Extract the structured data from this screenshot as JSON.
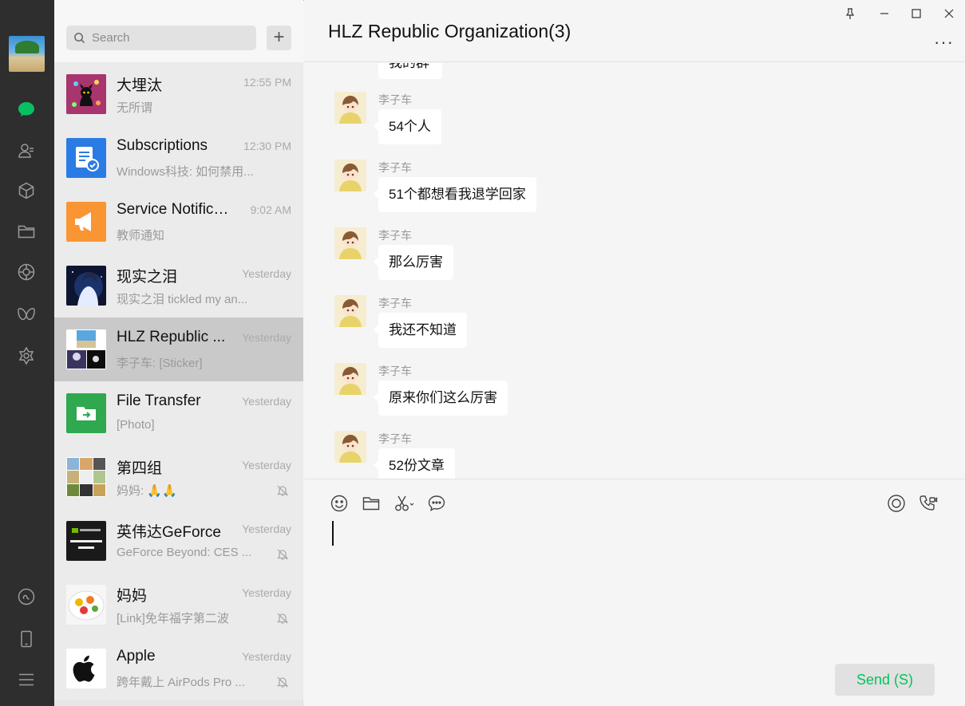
{
  "window": {
    "chat_title": "HLZ Republic Organization(3)",
    "more_label": "···"
  },
  "rail": {
    "items": [
      "chat-icon",
      "contacts-icon",
      "favorites-icon",
      "files-icon",
      "moments-icon",
      "channels-icon",
      "mini-programs-icon",
      "mini-program-link-icon",
      "phone-icon",
      "menu-icon"
    ],
    "accent": "#07c160"
  },
  "search": {
    "placeholder": "Search",
    "add_label": "+"
  },
  "chats": [
    {
      "name": "大埋汰",
      "time": "12:55 PM",
      "preview": "无所谓",
      "muted": false
    },
    {
      "name": "Subscriptions",
      "time": "12:30 PM",
      "preview": "Windows科技: 如何禁用...",
      "muted": false
    },
    {
      "name": "Service Notificat...",
      "time": "9:02 AM",
      "preview": "教师通知",
      "muted": false
    },
    {
      "name": "现实之泪",
      "time": "Yesterday",
      "preview": "现实之泪 tickled my  an...",
      "muted": false
    },
    {
      "name": "HLZ Republic ...",
      "time": "Yesterday",
      "preview": "李子车: [Sticker]",
      "muted": false
    },
    {
      "name": "File Transfer",
      "time": "Yesterday",
      "preview": "[Photo]",
      "muted": false
    },
    {
      "name": "第四组",
      "time": "Yesterday",
      "preview": "妈妈: 🙏🙏",
      "muted": true
    },
    {
      "name": "英伟达GeForce",
      "time": "Yesterday",
      "preview": "GeForce Beyond: CES ...",
      "muted": true
    },
    {
      "name": "妈妈",
      "time": "Yesterday",
      "preview": "[Link]免年福字第二波",
      "muted": true
    },
    {
      "name": "Apple",
      "time": "Yesterday",
      "preview": "跨年戴上 AirPods Pro ...",
      "muted": true
    }
  ],
  "messages": {
    "partial_text": "我的群",
    "items": [
      {
        "sender": "李子车",
        "text": "54个人"
      },
      {
        "sender": "李子车",
        "text": "51个都想看我退学回家"
      },
      {
        "sender": "李子车",
        "text": "那么厉害"
      },
      {
        "sender": "李子车",
        "text": "我还不知道"
      },
      {
        "sender": "李子车",
        "text": "原来你们这么厉害"
      },
      {
        "sender": "李子车",
        "text": "52份文章"
      }
    ]
  },
  "composer": {
    "send_label": "Send (S)"
  }
}
